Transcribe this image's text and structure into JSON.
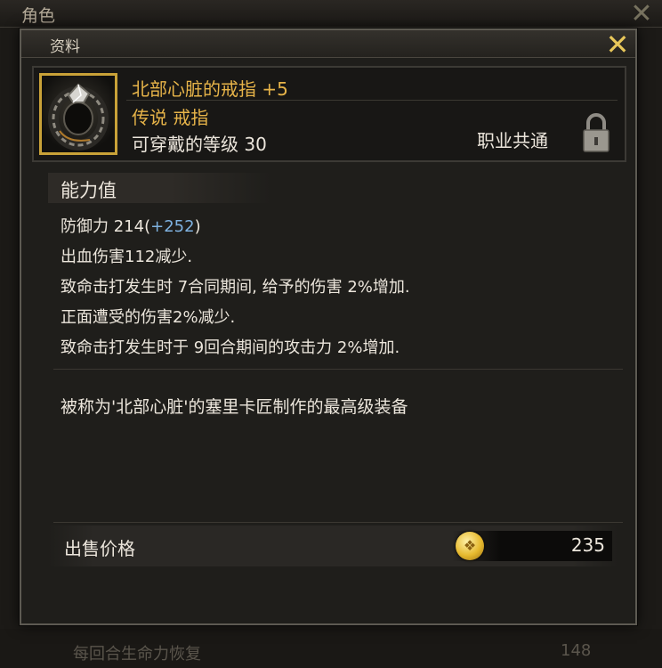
{
  "background_window": {
    "title": "角色",
    "bottom_row_label": "每回合生命力恢复",
    "bottom_row_value": "148"
  },
  "panel": {
    "title": "资料",
    "close_icon": "close-icon"
  },
  "item": {
    "name": "北部心脏的戒指 +5",
    "grade_type": "传说 戒指",
    "level_requirement": "可穿戴的等级 30",
    "class_restriction": "职业共通",
    "lock_icon": "lock-icon",
    "icon": "ring-icon"
  },
  "stats": {
    "title": "能力值",
    "defense_label": "防御力 214(",
    "defense_bonus": "+252",
    "defense_close": ")",
    "lines": [
      "出血伤害112减少.",
      "致命击打发生时 7合同期间, 给予的伤害 2%增加.",
      "正面遭受的伤害2%减少.",
      "致命击打发生时于 9回合期间的攻击力 2%增加."
    ]
  },
  "description": "被称为'北部心脏'的塞里卡匠制作的最高级装备",
  "price": {
    "label": "出售价格",
    "value": "235",
    "coin_icon": "gold-coin-icon"
  },
  "colors": {
    "item_name": "#e7b449",
    "stat_bonus": "#7fb2e0",
    "close_button": "#e8c75a",
    "icon_border": "#c9a238"
  }
}
